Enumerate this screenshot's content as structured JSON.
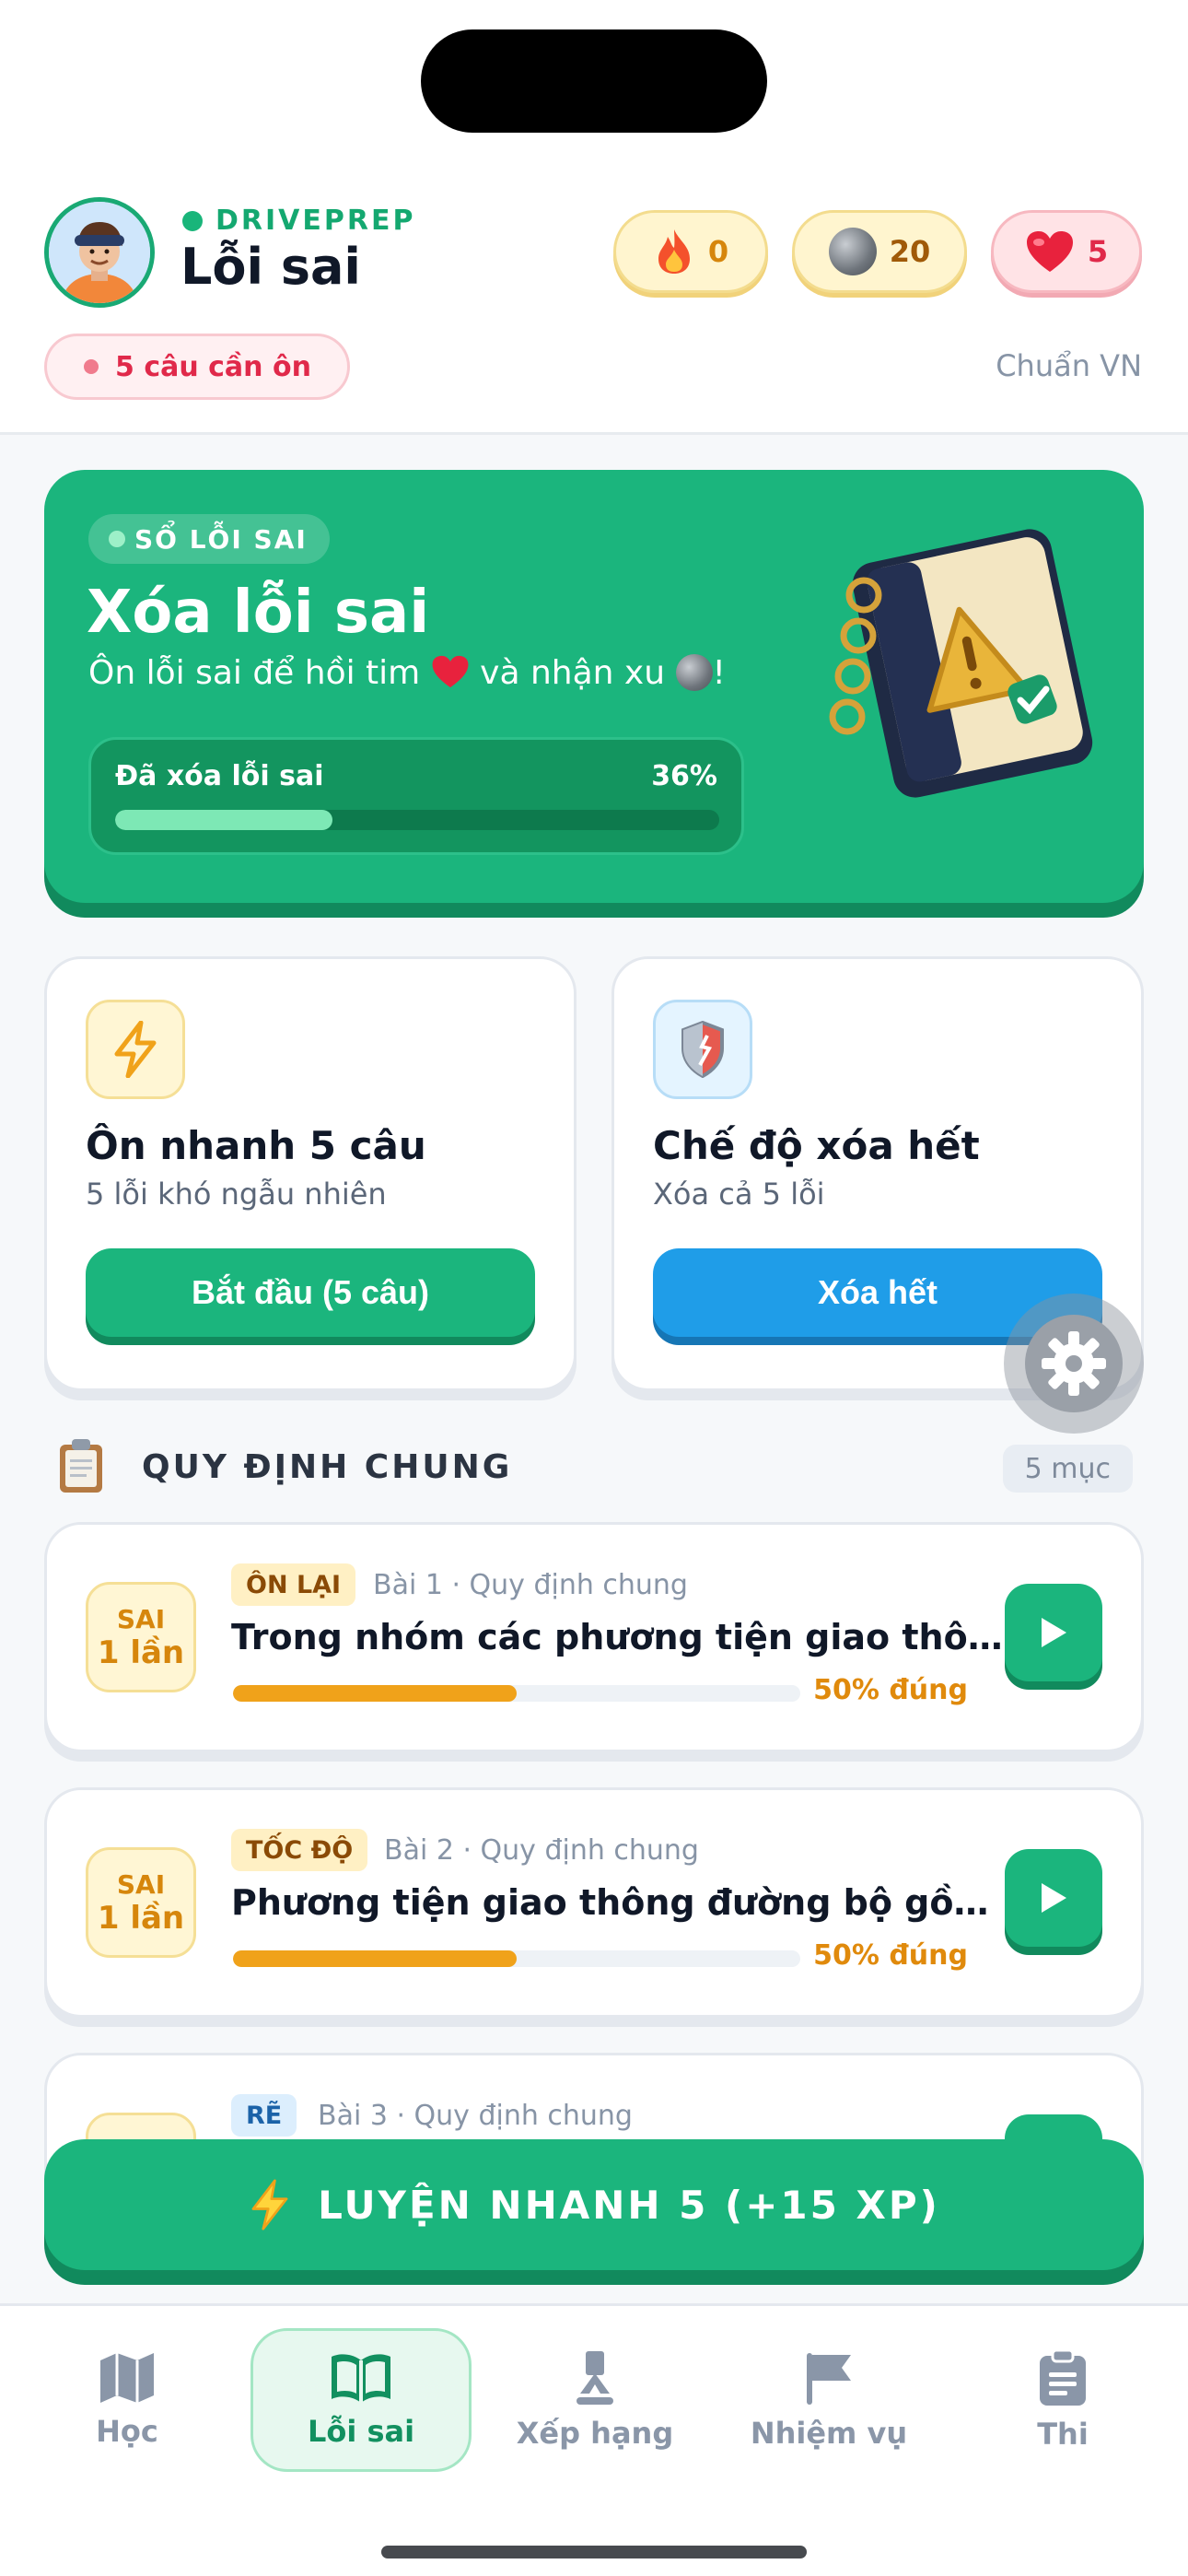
{
  "header": {
    "brand": "DRIVEPREP",
    "title": "Lỗi sai",
    "stats": {
      "streak": "0",
      "coins": "20",
      "hearts": "5"
    },
    "review_pill": "5 câu cần ôn",
    "standard": "Chuẩn VN"
  },
  "hero": {
    "badge": "SỔ LỖI SAI",
    "title": "Xóa lỗi sai",
    "subtitle_part1": "Ôn lỗi sai để hồi tim",
    "subtitle_part2": "và nhận xu",
    "subtitle_end": "!",
    "progress_label": "Đã xóa lỗi sai",
    "progress_text": "36%",
    "progress_value": 0.36
  },
  "cards": [
    {
      "title": "Ôn nhanh 5 câu",
      "subtitle": "5 lỗi khó ngẫu nhiên",
      "button": "Bắt đầu (5 câu)"
    },
    {
      "title": "Chế độ xóa hết",
      "subtitle": "Xóa cả 5 lỗi",
      "button": "Xóa hết"
    }
  ],
  "section": {
    "title": "QUY ĐỊNH CHUNG",
    "count": "5 mục"
  },
  "items": [
    {
      "wrong_top": "SAI",
      "wrong_bottom": "1 lần",
      "tag": "ÔN LẠI",
      "meta": "Bài 1 · Quy định chung",
      "question": "Trong nhóm các phương tiện giao thông...",
      "pct_text": "50% đúng",
      "pct": 0.5
    },
    {
      "wrong_top": "SAI",
      "wrong_bottom": "1 lần",
      "tag": "TỐC ĐỘ",
      "meta": "Bài 2 · Quy định chung",
      "question": "Phương tiện giao thông đường bộ gồm n...",
      "pct_text": "50% đúng",
      "pct": 0.5
    },
    {
      "tag": "RẼ",
      "meta": "Bài 3 · Quy định chung"
    }
  ],
  "cta": {
    "label": "LUYỆN NHANH 5 (+15 XP)"
  },
  "tabs": [
    {
      "label": "Học",
      "icon": "map-icon"
    },
    {
      "label": "Lỗi sai",
      "icon": "book-icon",
      "active": true
    },
    {
      "label": "Xếp hạng",
      "icon": "ribbon-icon"
    },
    {
      "label": "Nhiệm vụ",
      "icon": "flag-icon"
    },
    {
      "label": "Thi",
      "icon": "clipboard-icon"
    }
  ],
  "colors": {
    "primary": "#1bb57d",
    "primary_dark": "#118a5d",
    "blue": "#1f9de8",
    "danger": "#e0294a",
    "warning": "#f0a21a"
  }
}
